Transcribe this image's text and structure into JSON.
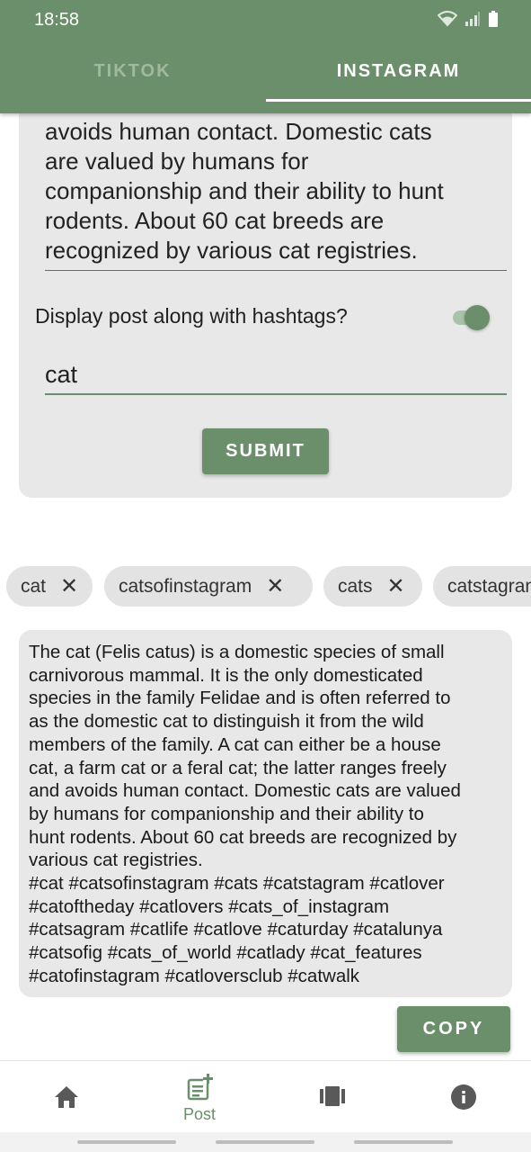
{
  "status_bar": {
    "time": "18:58"
  },
  "tabs": [
    {
      "label": "TIKTOK",
      "active": false
    },
    {
      "label": "INSTAGRAM",
      "active": true
    }
  ],
  "form": {
    "description_lines": [
      "avoids human contact. Domestic cats",
      "are valued by humans for",
      "companionship and their ability to hunt",
      "rodents. About 60 cat breeds are",
      "recognized by various cat registries."
    ],
    "toggle_label": "Display post along with hashtags?",
    "toggle_on": true,
    "hashtag_input_value": "cat",
    "submit_label": "SUBMIT"
  },
  "chips": [
    "cat",
    "catsofinstagram",
    "cats",
    "catstagram"
  ],
  "output_lines": [
    "The cat (Felis catus) is a domestic species of small",
    "carnivorous mammal. It is the only domesticated",
    "species in the family Felidae and is often referred to",
    "as the domestic cat to distinguish it from the wild",
    "members of the family. A cat can either be a house",
    "cat, a farm cat or a feral cat; the latter ranges freely",
    "and avoids human contact. Domestic cats are valued",
    "by humans for companionship and their ability to",
    "hunt rodents. About 60 cat breeds are recognized by",
    "various cat registries.",
    "#cat #catsofinstagram #cats #catstagram #catlover",
    "#catoftheday #catlovers #cats_of_instagram",
    "#catsagram #catlife #catlove #caturday #catalunya",
    "#catsofig #cats_of_world #catlady #cat_features",
    "#catofinstagram #catloversclub #catwalk"
  ],
  "copy_label": "COPY",
  "bottom_nav": [
    {
      "icon": "home-icon",
      "label": ""
    },
    {
      "icon": "post-add-icon",
      "label": "Post"
    },
    {
      "icon": "carousel-icon",
      "label": ""
    },
    {
      "icon": "info-icon",
      "label": ""
    }
  ],
  "colors": {
    "primary": "#6b8f6b",
    "card": "#e8e8e8"
  }
}
